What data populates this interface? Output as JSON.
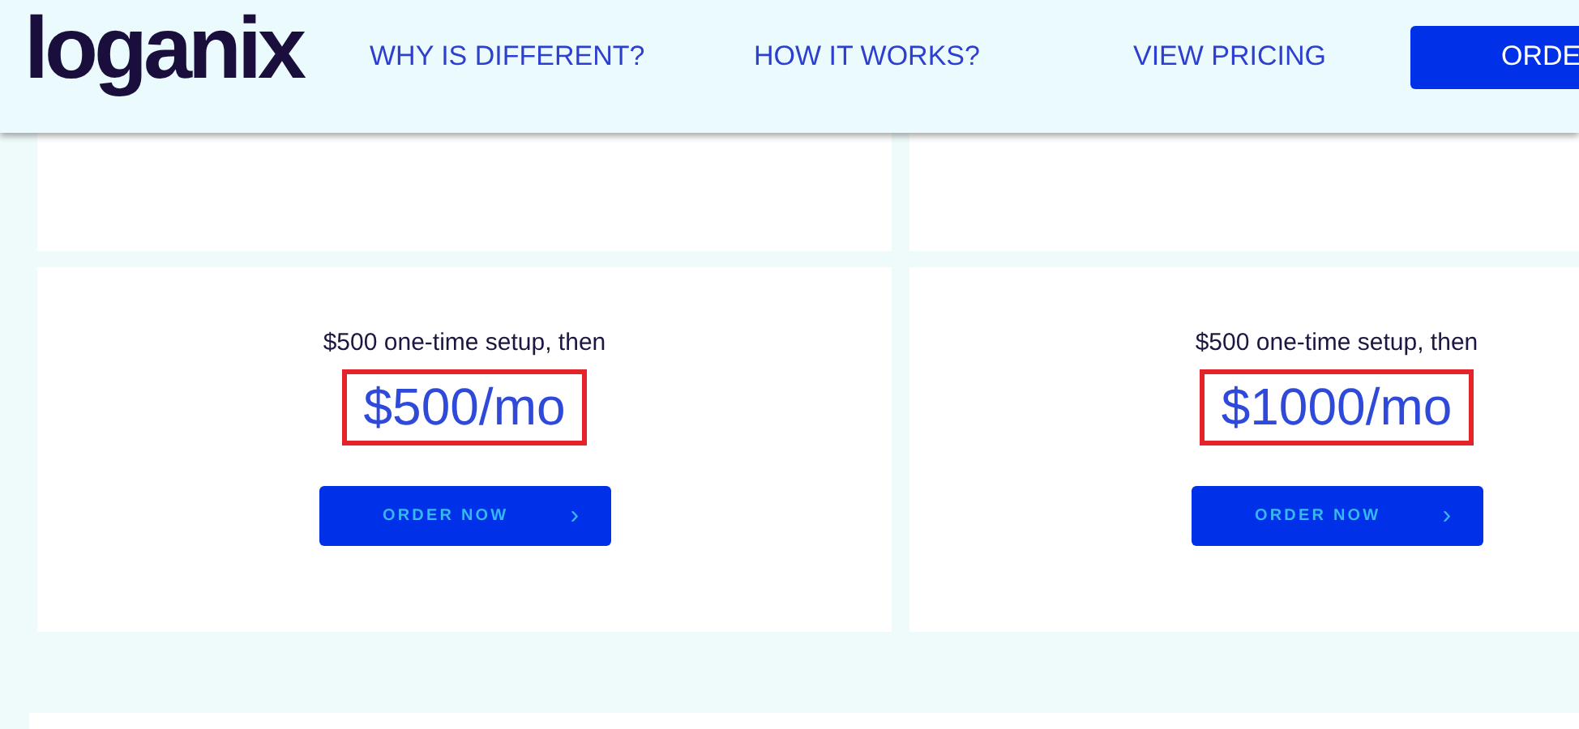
{
  "header": {
    "logo": "loganix",
    "nav": [
      "WHY IS DIFFERENT?",
      "HOW IT WORKS?",
      "VIEW PRICING"
    ],
    "order_button": "ORDE"
  },
  "plans": [
    {
      "setup": "$500 one-time setup, then",
      "price": "$500/mo",
      "highlighted": true,
      "button": "ORDER NOW",
      "button_icon": "›"
    },
    {
      "setup": "$500 one-time setup, then",
      "price": "$1000/mo",
      "highlighted": true,
      "button": "ORDER NOW",
      "button_icon": "›"
    }
  ]
}
